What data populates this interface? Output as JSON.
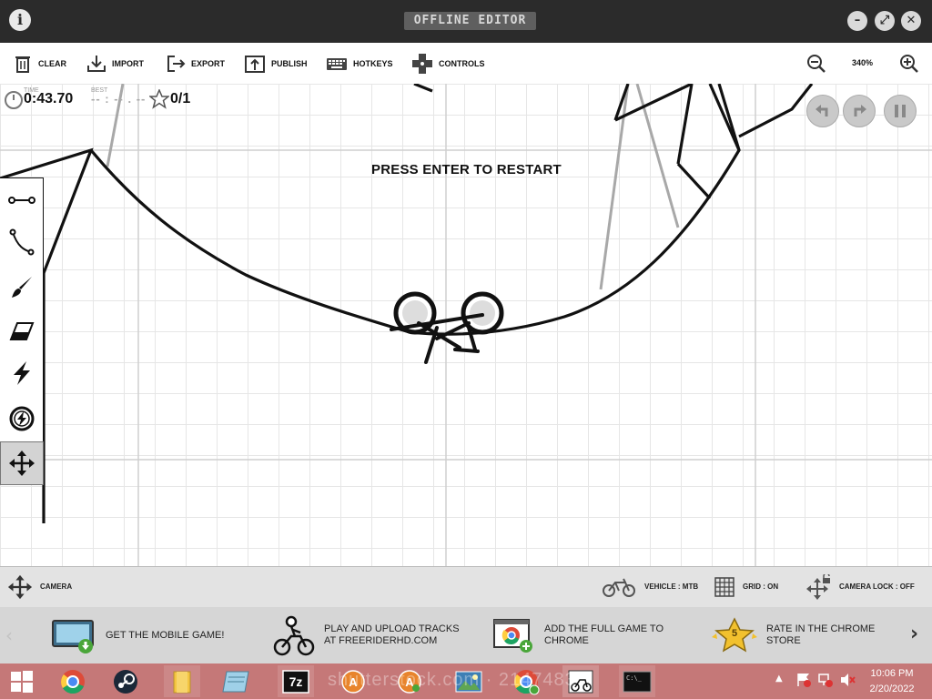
{
  "window": {
    "title": "OFFLINE EDITOR",
    "info_icon": "info-icon",
    "controls": [
      "minimize-icon",
      "maximize-icon",
      "close-icon"
    ]
  },
  "toolbar": {
    "clear": "CLEAR",
    "import": "IMPORT",
    "export": "EXPORT",
    "publish": "PUBLISH",
    "hotkeys": "HOTKEYS",
    "controls": "CONTROLS",
    "zoom": "340%"
  },
  "hud": {
    "time_label": "TIME",
    "time": "0:43.70",
    "best_label": "BEST",
    "best": "-- : -- . --",
    "stars": "0/1"
  },
  "game": {
    "message": "PRESS ENTER TO RESTART"
  },
  "side_tools": [
    "line-icon",
    "curve-icon",
    "brush-icon",
    "eraser-icon",
    "boost-icon",
    "powerup-icon",
    "camera-move-icon"
  ],
  "statusbar": {
    "camera": "CAMERA",
    "vehicle": "VEHICLE : MTB",
    "grid": "GRID : ON",
    "camera_lock": "CAMERA LOCK : OFF"
  },
  "promos": [
    {
      "line1": "GET THE MOBILE GAME!",
      "line2": ""
    },
    {
      "line1": "PLAY AND UPLOAD TRACKS",
      "line2": "AT FREERIDERHD.COM"
    },
    {
      "line1": "ADD THE FULL GAME TO",
      "line2": "CHROME"
    },
    {
      "line1": "RATE IN THE CHROME",
      "line2": "STORE"
    }
  ],
  "rate_badge": "5",
  "taskbar": {
    "time": "10:06 PM",
    "date": "2/20/2022",
    "watermark": "shutterstock.com · 2147483"
  },
  "colors": {
    "titlebar": "#2b2b2b",
    "taskbar": "#c57878",
    "promo_bg": "#d6d6d6",
    "status_bg": "#e3e3e3"
  }
}
